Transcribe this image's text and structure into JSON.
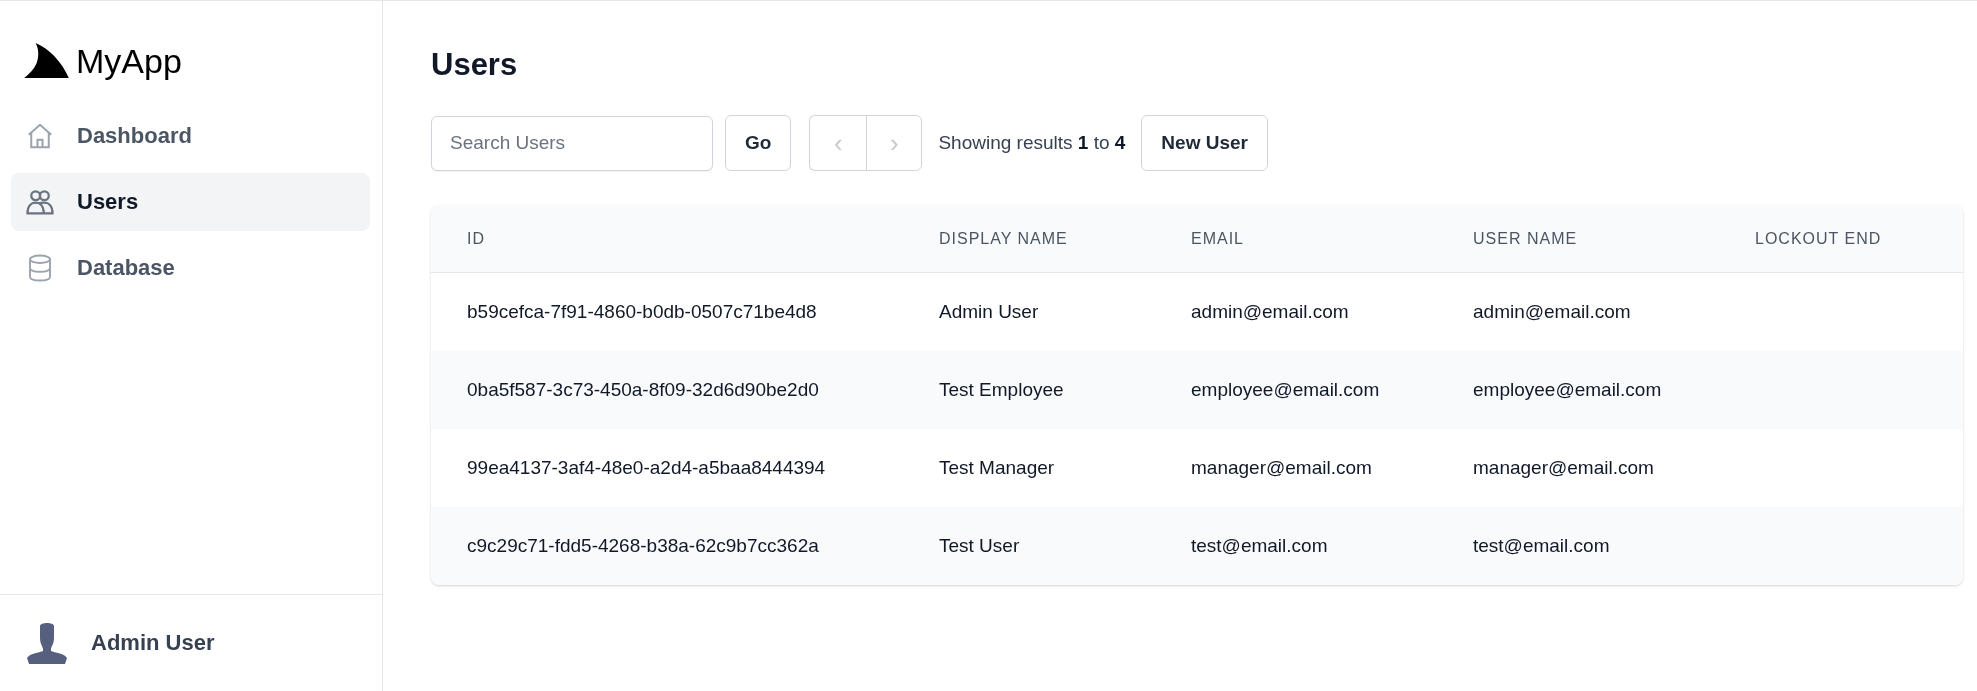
{
  "sidebar": {
    "brand": "MyApp",
    "items": [
      {
        "label": "Dashboard",
        "kind": "home",
        "selected": false
      },
      {
        "label": "Users",
        "kind": "users",
        "selected": true
      },
      {
        "label": "Database",
        "kind": "database",
        "selected": false
      }
    ],
    "user": {
      "name": "Admin User"
    }
  },
  "page": {
    "title": "Users"
  },
  "toolbar": {
    "search": {
      "placeholder": "Search Users"
    },
    "go_button": "Go",
    "pager": [
      {
        "symbol": "‹",
        "disabled": true
      },
      {
        "symbol": "›",
        "disabled": true
      }
    ],
    "results_text": "Showing results **1** to **4**",
    "new_button": "New User"
  },
  "table": {
    "columns": [
      "ID",
      "DISPLAY NAME",
      "EMAIL",
      "USER NAME",
      "LOCKOUT END"
    ],
    "rows": [
      {
        "id": "b59cefca-7f91-4860-b0db-0507c71be4d8",
        "display_name": "Admin User",
        "email": "admin@email.com",
        "user_name": "admin@email.com"
      },
      {
        "id": "0ba5f587-3c73-450a-8f09-32d6d90be2d0",
        "display_name": "Test Employee",
        "email": "employee@email.com",
        "user_name": "employee@email.com"
      },
      {
        "id": "99ea4137-3af4-48e0-a2d4-a5baa8444394",
        "display_name": "Test Manager",
        "email": "manager@email.com",
        "user_name": "manager@email.com"
      },
      {
        "id": "c9c29c71-fdd5-4268-b38a-62c9b7cc362a",
        "display_name": "Test User",
        "email": "test@email.com",
        "user_name": "test@email.com"
      }
    ]
  }
}
